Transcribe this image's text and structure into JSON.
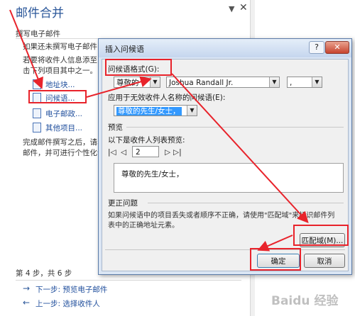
{
  "pane": {
    "title": "邮件合并",
    "menu_arrow": "▼",
    "close": "✕",
    "section_write": "撰写电子邮件",
    "intro_line1": "如果还未撰写电子邮件",
    "intro_line2": "若要将收件人信息添至",
    "intro_line3": "击下列项目其中之一。",
    "links": [
      "地址块...",
      "问候语...",
      "电子邮政...",
      "其他项目..."
    ],
    "outro_line1": "完成邮件撰写之后，请单",
    "outro_line2": "邮件，并可进行个性化设",
    "step": "第 4 步，共 6 步",
    "next": "下一步: 预览电子邮件",
    "prev": "上一步: 选择收件人"
  },
  "dialog": {
    "title": "插入问候语",
    "help": "?",
    "close": "✕",
    "format_label": "问候语格式(G):",
    "format_values": [
      "尊敬的",
      "Joshua Randall Jr.",
      ","
    ],
    "invalid_label": "应用于无效收件人名称的问候语(E):",
    "invalid_value": "尊敬的先生/女士，",
    "preview_group": "预览",
    "preview_label": "以下是收件人列表预览:",
    "nav_first": "|◁",
    "nav_prev": "◁",
    "record": "2",
    "nav_next": "▷",
    "nav_last": "▷|",
    "preview_text": "尊敬的先生/女士，",
    "correct_group": "更正问题",
    "correct_text1": "如果问候语中的项目丢失或者顺序不正确，请使用\"匹配域\"来标识邮件列",
    "correct_text2": "表中的正确地址元素。",
    "match_button": "匹配域(M)...",
    "ok_button": "确定",
    "cancel_button": "取消"
  },
  "watermark": "Baidu 经验",
  "colors": {
    "annotation": "#e8232b",
    "pane_title": "#2b579a",
    "selection": "#3399ff"
  }
}
